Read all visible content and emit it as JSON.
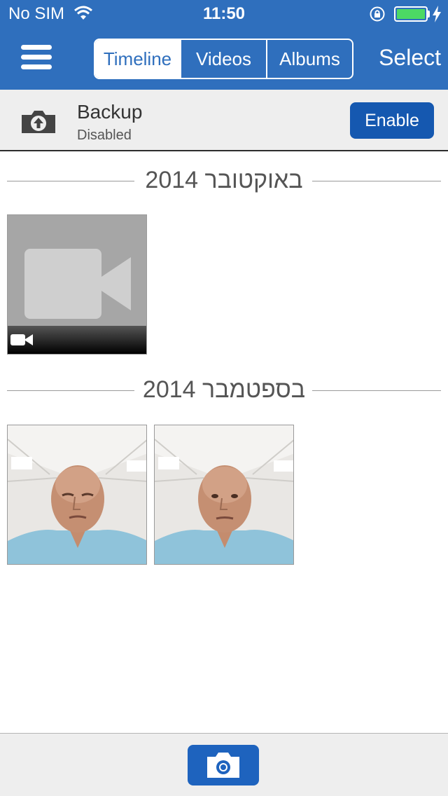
{
  "status_bar": {
    "carrier": "No SIM",
    "time": "11:50",
    "battery_level": 1.0,
    "charging": true
  },
  "nav": {
    "tabs": [
      {
        "label": "Timeline",
        "active": true
      },
      {
        "label": "Videos",
        "active": false
      },
      {
        "label": "Albums",
        "active": false
      }
    ],
    "select_label": "Select",
    "menu_icon": "hamburger-menu-icon"
  },
  "backup": {
    "title": "Backup",
    "status": "Disabled",
    "enable_label": "Enable",
    "icon": "cloud-upload-icon"
  },
  "sections": [
    {
      "title": "באוקטובר 2014",
      "items": [
        {
          "type": "video"
        }
      ]
    },
    {
      "title": "בספטמבר 2014",
      "items": [
        {
          "type": "photo"
        },
        {
          "type": "photo"
        }
      ]
    }
  ],
  "toolbar": {
    "camera_icon": "camera-icon"
  },
  "colors": {
    "brand_blue": "#2f6fbd",
    "button_blue": "#1558b0",
    "battery_green": "#4cd964"
  }
}
